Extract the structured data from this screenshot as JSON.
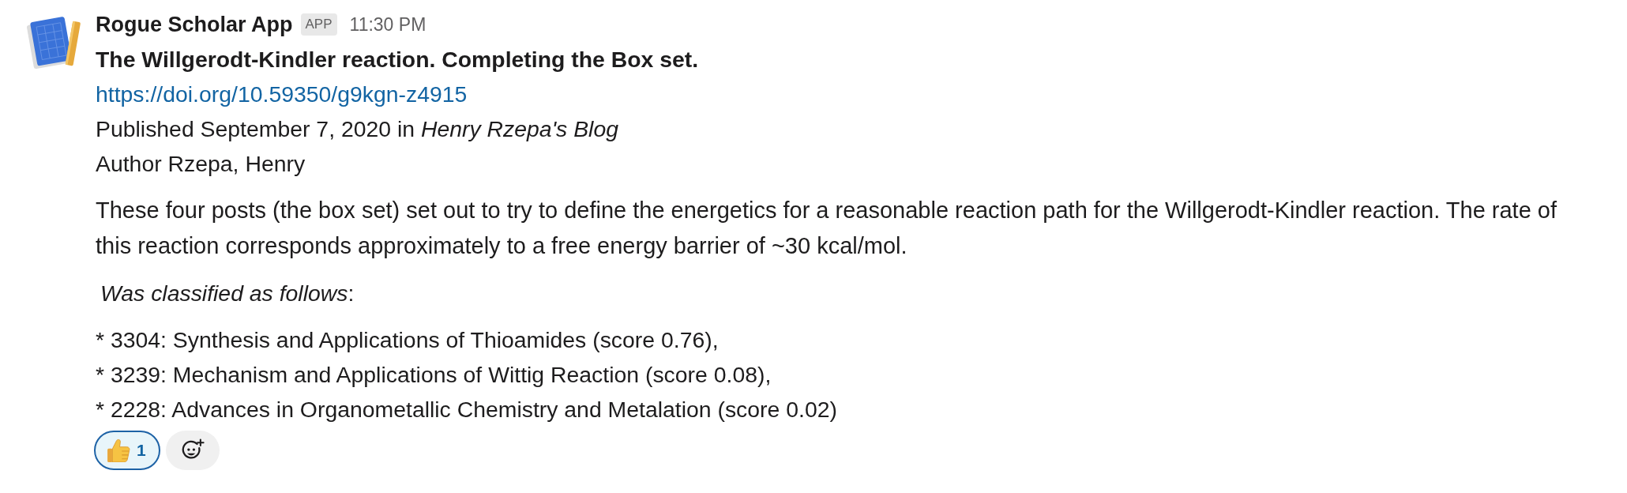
{
  "message": {
    "sender": "Rogue Scholar App",
    "badge": "APP",
    "time": "11:30 PM",
    "title": "The Willgerodt-Kindler reaction. Completing the Box set.",
    "link": "https://doi.org/10.59350/g9kgn-z4915",
    "published": "Published September 7, 2020 in *Henry Rzepa's Blog*",
    "author": "Author Rzepa, Henry",
    "summary": "These four posts (the box set) set out to try to define the energetics for a reasonable reaction path for the Willgerodt-Kindler reaction. The rate of this reaction corresponds approximately to a free energy barrier of ~30 kcal/mol.",
    "classification_intro": "*Was classified as follows*:",
    "classifications": [
      "* 3304: Synthesis and Applications of Thioamides (score 0.76),",
      "* 3239: Mechanism and Applications of Wittig Reaction (score 0.08),",
      "* 2228: Advances in Organometallic Chemistry and Metalation (score 0.02)"
    ]
  },
  "reactions": [
    {
      "count": "1",
      "selected": true
    }
  ]
}
